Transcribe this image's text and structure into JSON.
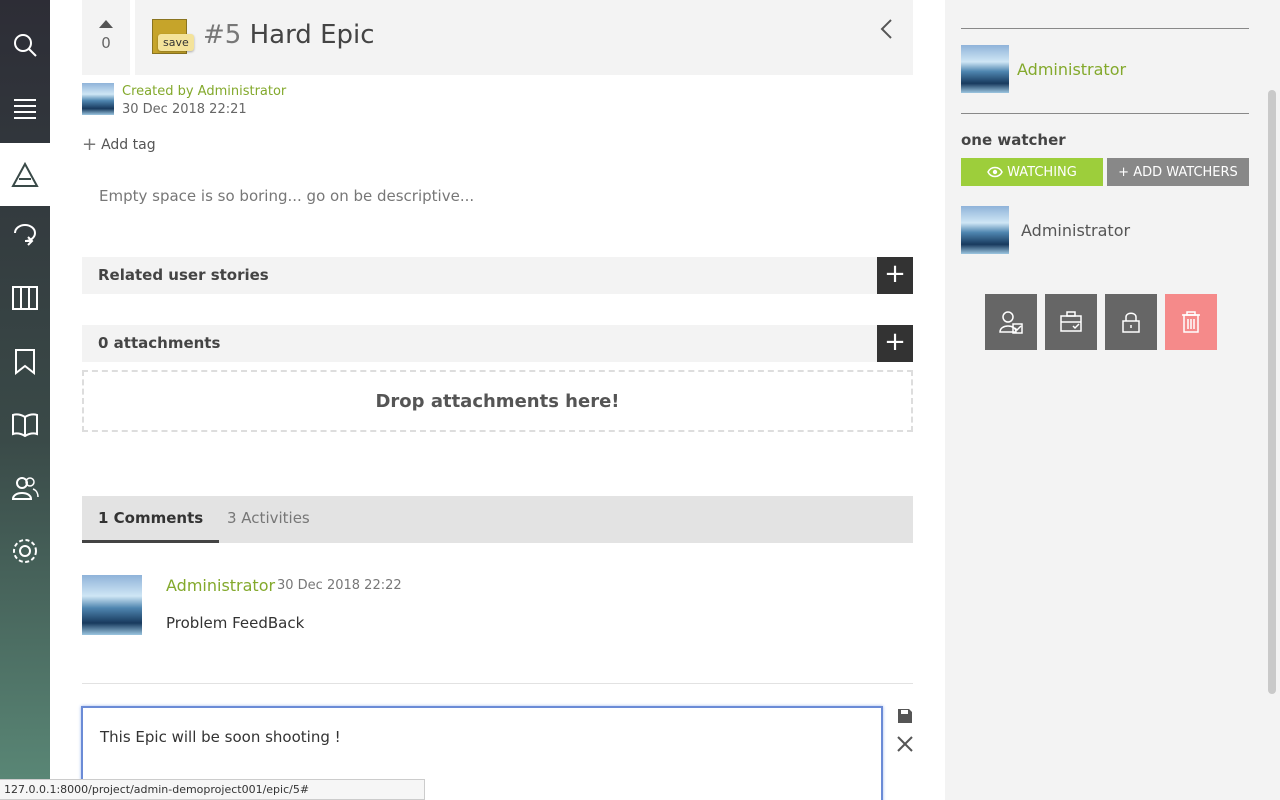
{
  "nav": {
    "items": [
      {
        "id": "search",
        "icon": "search-icon"
      },
      {
        "id": "menu",
        "icon": "menu-icon"
      },
      {
        "id": "epics",
        "icon": "epic-icon",
        "active": true
      },
      {
        "id": "backlog",
        "icon": "scrum-icon"
      },
      {
        "id": "kanban",
        "icon": "kanban-icon"
      },
      {
        "id": "issues",
        "icon": "bookmark-icon"
      },
      {
        "id": "wiki",
        "icon": "book-icon"
      },
      {
        "id": "team",
        "icon": "team-icon"
      },
      {
        "id": "admin",
        "icon": "settings-icon"
      }
    ]
  },
  "header": {
    "votes": "0",
    "save_tooltip": "save",
    "ref": "#5",
    "title": "Hard Epic"
  },
  "creator": {
    "by": "Created by Administrator",
    "date": "30 Dec 2018 22:21"
  },
  "tags": {
    "add_label": "Add tag"
  },
  "description": {
    "placeholder": "Empty space is so boring... go on be descriptive..."
  },
  "related": {
    "label": "Related user stories",
    "add": "+"
  },
  "attachments": {
    "label": "0 attachments",
    "add": "+",
    "drop_text": "Drop attachments here!"
  },
  "tabs": {
    "comments": "1 Comments",
    "activities": "3 Activities"
  },
  "comment": {
    "author": "Administrator",
    "date": "30 Dec 2018 22:22",
    "text": "Problem FeedBack"
  },
  "editor": {
    "text": "This Epic will be soon shooting !"
  },
  "status_url": "127.0.0.1:8000/project/admin-demoproject001/epic/5#",
  "sidebar": {
    "assigned_name": "Administrator",
    "watchers_title": "one watcher",
    "watching_label": "WATCHING",
    "add_watchers_label": "+ ADD WATCHERS",
    "watcher_name": "Administrator"
  },
  "colors": {
    "accent_green": "#83a92c",
    "watching_green": "#9dce3b",
    "delete_red": "#f58a8a",
    "status_gold": "#c6a42a"
  }
}
